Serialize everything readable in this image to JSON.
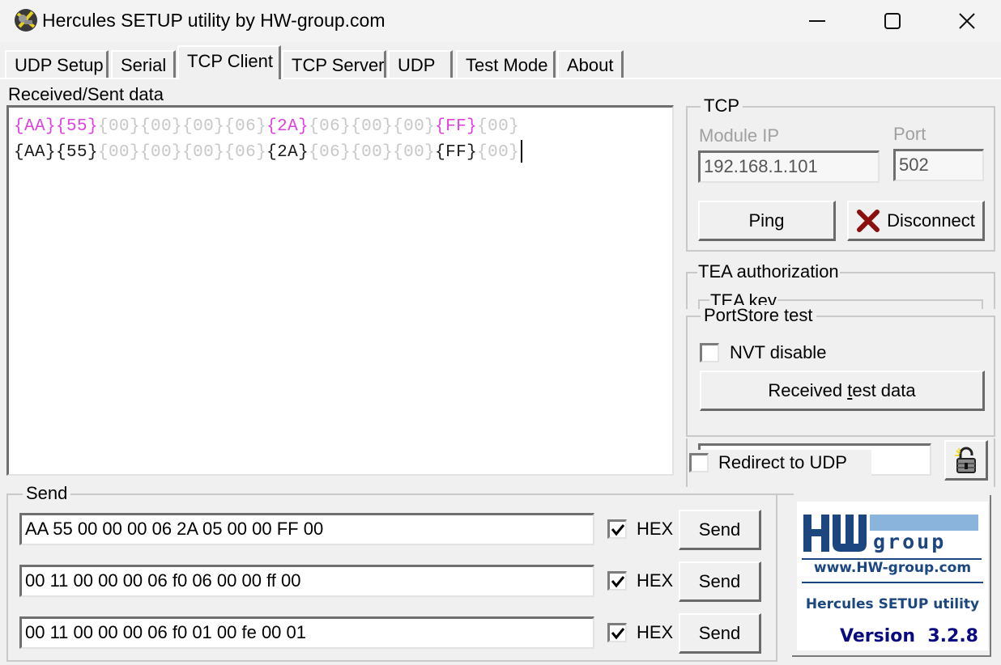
{
  "window": {
    "title": "Hercules SETUP utility by HW-group.com",
    "controls": {
      "minimize": "minimize-icon",
      "maximize": "maximize-icon",
      "close": "close-icon"
    }
  },
  "tabs": [
    {
      "label": "UDP Setup",
      "active": false
    },
    {
      "label": "Serial",
      "active": false
    },
    {
      "label": "TCP Client",
      "active": true
    },
    {
      "label": "TCP Server",
      "active": false
    },
    {
      "label": "UDP",
      "active": false
    },
    {
      "label": "Test Mode",
      "active": false
    },
    {
      "label": "About",
      "active": false
    }
  ],
  "received": {
    "label": "Received/Sent data",
    "lines": [
      {
        "kind": "sent",
        "tokens": [
          "{AA}",
          "{55}",
          "{00}",
          "{00}",
          "{00}",
          "{06}",
          "{2A}",
          "{06}",
          "{00}",
          "{00}",
          "{FF}",
          "{00}"
        ]
      },
      {
        "kind": "received",
        "tokens": [
          "{AA}",
          "{55}",
          "{00}",
          "{00}",
          "{00}",
          "{06}",
          "{2A}",
          "{06}",
          "{00}",
          "{00}",
          "{FF}",
          "{00}"
        ]
      }
    ],
    "colors": {
      "sent": "#e040e0",
      "received": "#1a1a1a",
      "muted": "#c8c8c8"
    }
  },
  "tcp": {
    "legend": "TCP",
    "module_ip_label": "Module IP",
    "module_ip": "192.168.1.101",
    "port_label": "Port",
    "port": "502",
    "ping_label": "Ping",
    "disconnect_label": "Disconnect"
  },
  "tea": {
    "legend": "TEA authorization",
    "key_legend": "TEA key"
  },
  "portstore": {
    "legend": "PortStore test",
    "nvt_label": "NVT disable",
    "nvt_checked": false,
    "received_test_prefix": "Received ",
    "received_test_ul": "t",
    "received_test_suffix": "est data"
  },
  "redirect": {
    "label": "Redirect to UDP",
    "checked": false,
    "value": ""
  },
  "send": {
    "legend": "Send",
    "rows": [
      {
        "value": "AA 55 00 00 00 06 2A 05 00 00 FF 00",
        "hex_label": "HEX",
        "hex_checked": true,
        "button": "Send"
      },
      {
        "value": "00 11 00 00 00 06 f0 06 00 00 ff 00",
        "hex_label": "HEX",
        "hex_checked": true,
        "button": "Send"
      },
      {
        "value": "00 11 00 00 00 06 f0 01 00 fe 00 01",
        "hex_label": "HEX",
        "hex_checked": true,
        "button": "Send"
      }
    ]
  },
  "logo": {
    "brand_hw": "HW",
    "brand_group": "group",
    "url": "www.HW-group.com",
    "product": "Hercules SETUP utility",
    "version": "Version  3.2.8",
    "colors": {
      "dark": "#1b4680",
      "light": "#8ab4dc",
      "version": "#0a0a80"
    }
  }
}
